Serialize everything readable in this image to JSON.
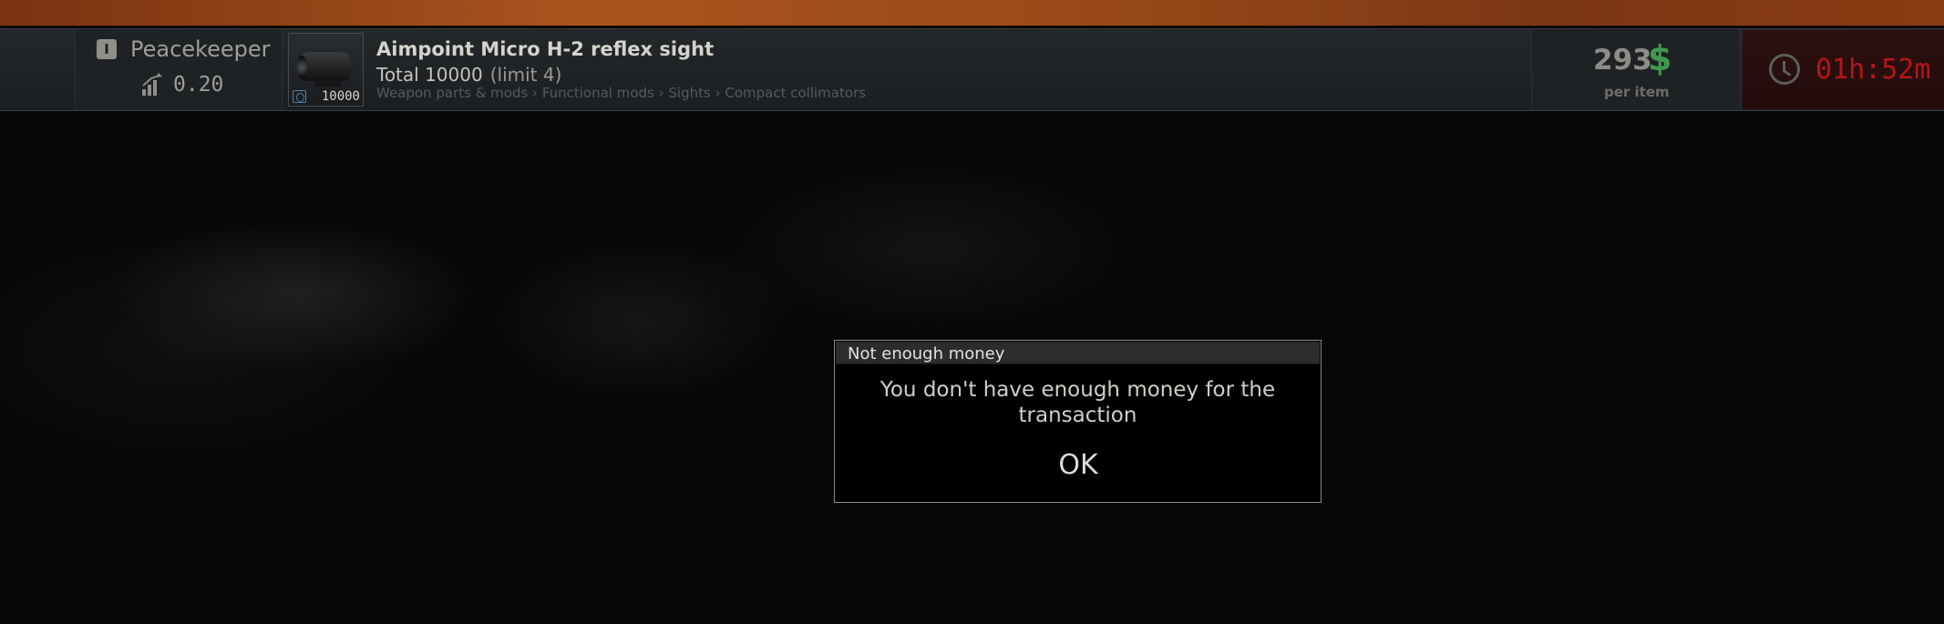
{
  "offer": {
    "trader": {
      "name": "Peacekeeper",
      "level_badge": "I",
      "rating": "0.20",
      "rating_icon": "signal-bars-icon"
    },
    "item": {
      "name": "Aimpoint Micro H-2 reflex sight",
      "stack_count": "10000",
      "total_label": "Total 10000",
      "limit_label": "(limit 4)",
      "category_path": "Weapon parts & mods › Functional mods › Sights › Compact collimators",
      "badge_icon": "found-in-raid-icon"
    },
    "price": {
      "value": "293",
      "currency_symbol": "$",
      "per_label": "per item",
      "currency_color": "#3f9a4a"
    },
    "timer": {
      "value": "01h:52m",
      "icon": "clock-icon",
      "color": "#b51616"
    }
  },
  "dialog": {
    "title": "Not enough money",
    "message": "You don't have enough money for the transaction",
    "ok_label": "OK"
  },
  "colors": {
    "top_strip": "#a8541e",
    "background": "#050505"
  }
}
